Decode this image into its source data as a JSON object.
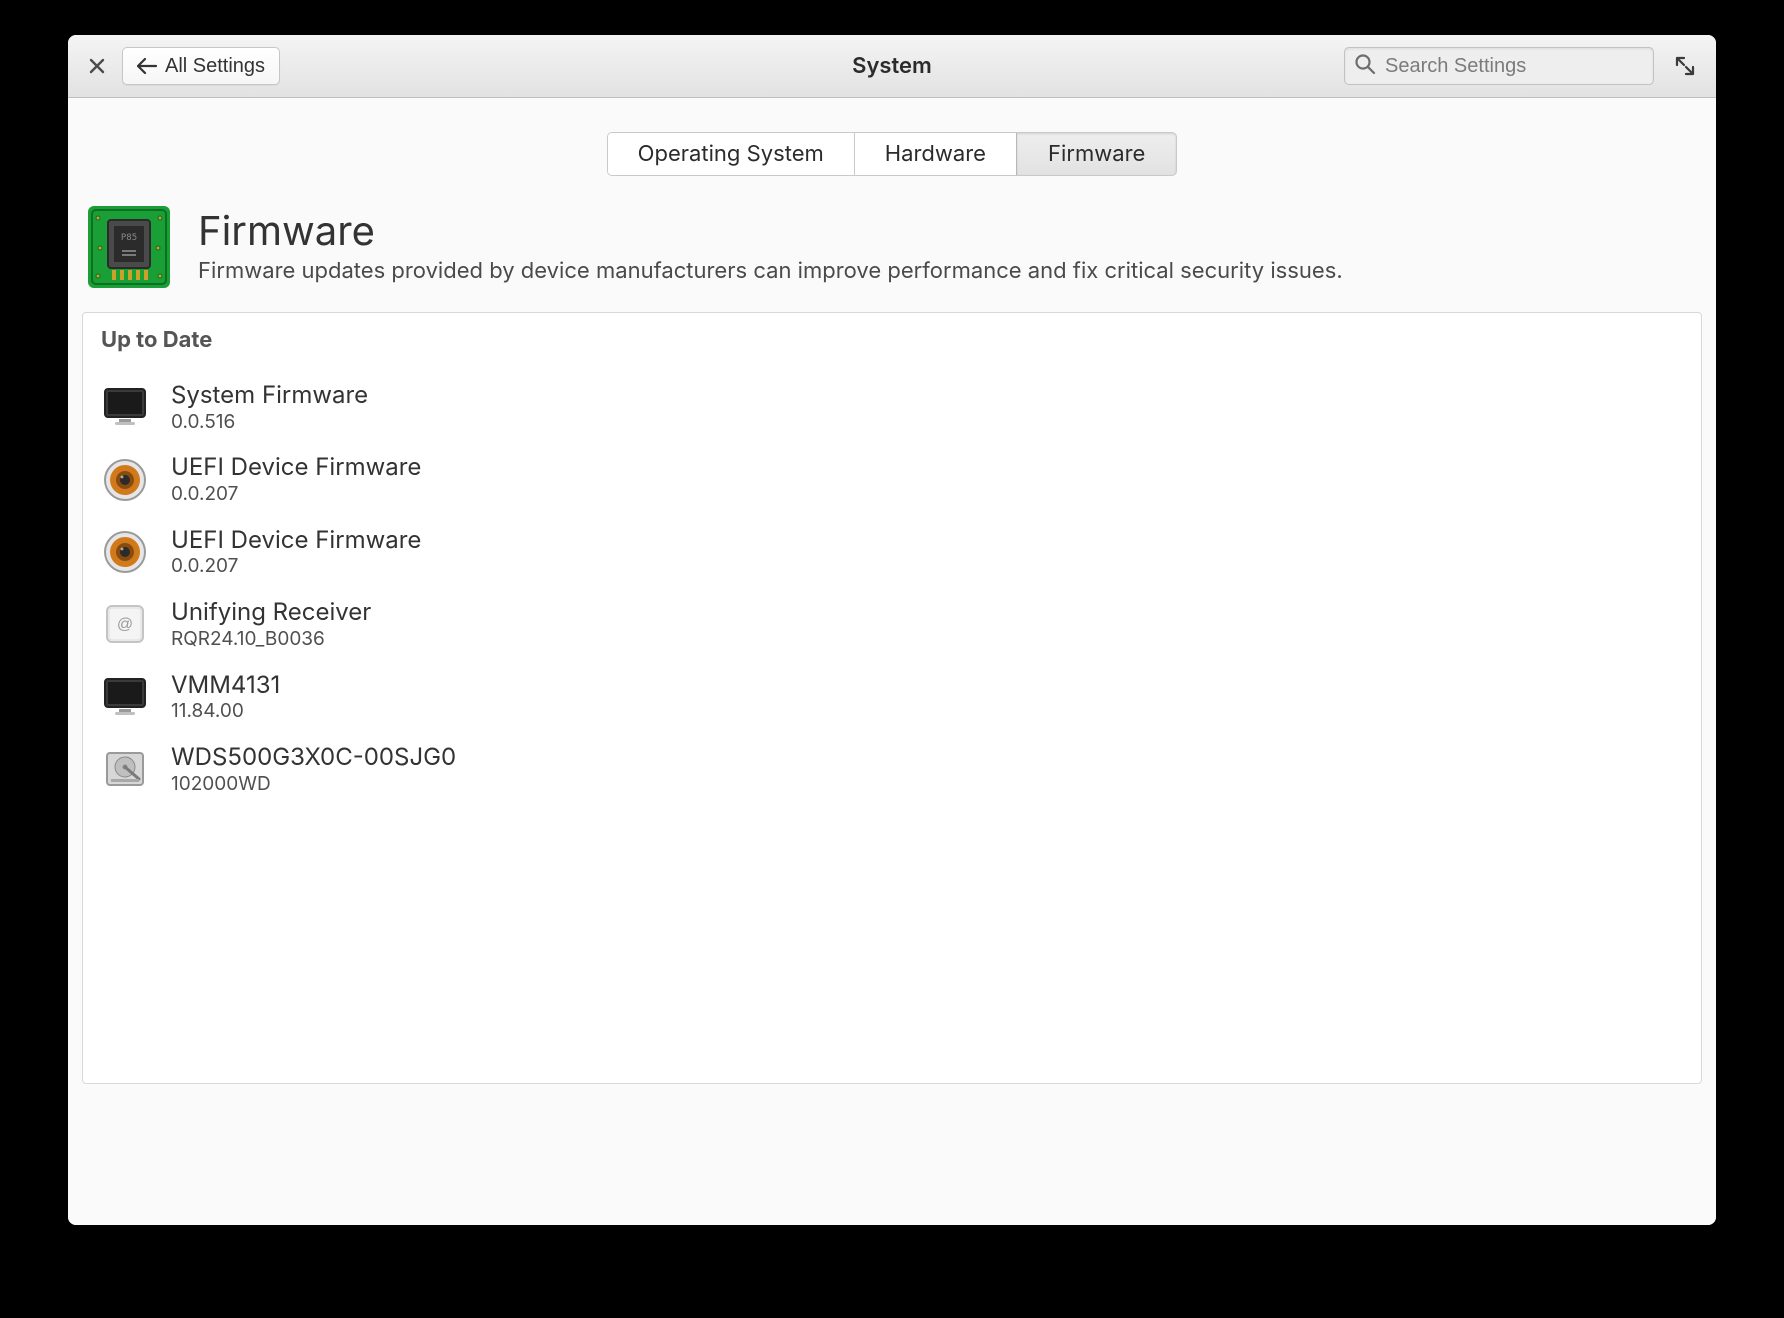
{
  "header": {
    "title": "System",
    "back_button_label": "All Settings",
    "search_placeholder": "Search Settings"
  },
  "tabs": [
    {
      "label": "Operating System",
      "active": false
    },
    {
      "label": "Hardware",
      "active": false
    },
    {
      "label": "Firmware",
      "active": true
    }
  ],
  "page": {
    "title": "Firmware",
    "subtitle": "Firmware updates provided by device manufacturers can improve performance and fix critical security issues."
  },
  "list": {
    "heading": "Up to Date",
    "items": [
      {
        "icon": "monitor",
        "name": "System Firmware",
        "version": "0.0.516"
      },
      {
        "icon": "speaker",
        "name": "UEFI Device Firmware",
        "version": "0.0.207"
      },
      {
        "icon": "speaker",
        "name": "UEFI Device Firmware",
        "version": "0.0.207"
      },
      {
        "icon": "receiver",
        "name": "Unifying Receiver",
        "version": "RQR24.10_B0036"
      },
      {
        "icon": "monitor",
        "name": "VMM4131",
        "version": "11.84.00"
      },
      {
        "icon": "hdd",
        "name": "WDS500G3X0C-00SJG0",
        "version": "102000WD"
      }
    ]
  }
}
